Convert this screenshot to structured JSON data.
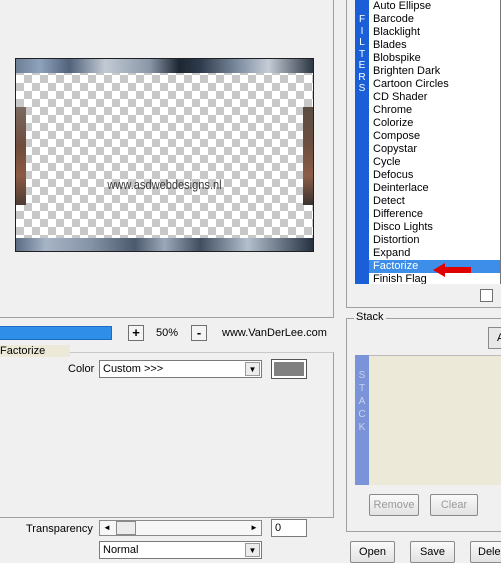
{
  "preview": {
    "watermark_text": "www.asdwebdesigns.nl"
  },
  "filters": {
    "strip_label": "FILTERS",
    "items": [
      "Auto Ellipse",
      "Barcode",
      "Blacklight",
      "Blades",
      "Blobspike",
      "Brighten Dark",
      "Cartoon Circles",
      "CD Shader",
      "Chrome",
      "Colorize",
      "Compose",
      "Copystar",
      "Cycle",
      "Defocus",
      "Deinterlace",
      "Detect",
      "Difference",
      "Disco Lights",
      "Distortion",
      "Expand",
      "Factorize",
      "Finish Flag"
    ],
    "selected": "Factorize"
  },
  "zoom": {
    "plus": "+",
    "value": "50%",
    "minus": "-"
  },
  "website": "www.VanDerLee.com",
  "factorize": {
    "title": "Factorize",
    "color_label": "Color",
    "color_value": "Custom >>>",
    "color_swatch": "#808080"
  },
  "transparency": {
    "label": "Transparency",
    "value": "0",
    "left_arrow": "◄",
    "right_arrow": "►"
  },
  "blend_mode": "Normal",
  "stack": {
    "title": "Stack",
    "strip_label": "STACK",
    "add_button": "A",
    "remove_button": "Remove",
    "clear_button": "Clear"
  },
  "buttons": {
    "open": "Open",
    "save": "Save",
    "delete": "Dele"
  },
  "colors": {
    "filter_strip": "#1a5fd8",
    "selected_item": "#3d8ee8",
    "arrow": "#e00000",
    "stack_strip": "#7b93d8",
    "stack_bg": "#ede9d8",
    "zoom_bar": "#2f8fe8"
  }
}
